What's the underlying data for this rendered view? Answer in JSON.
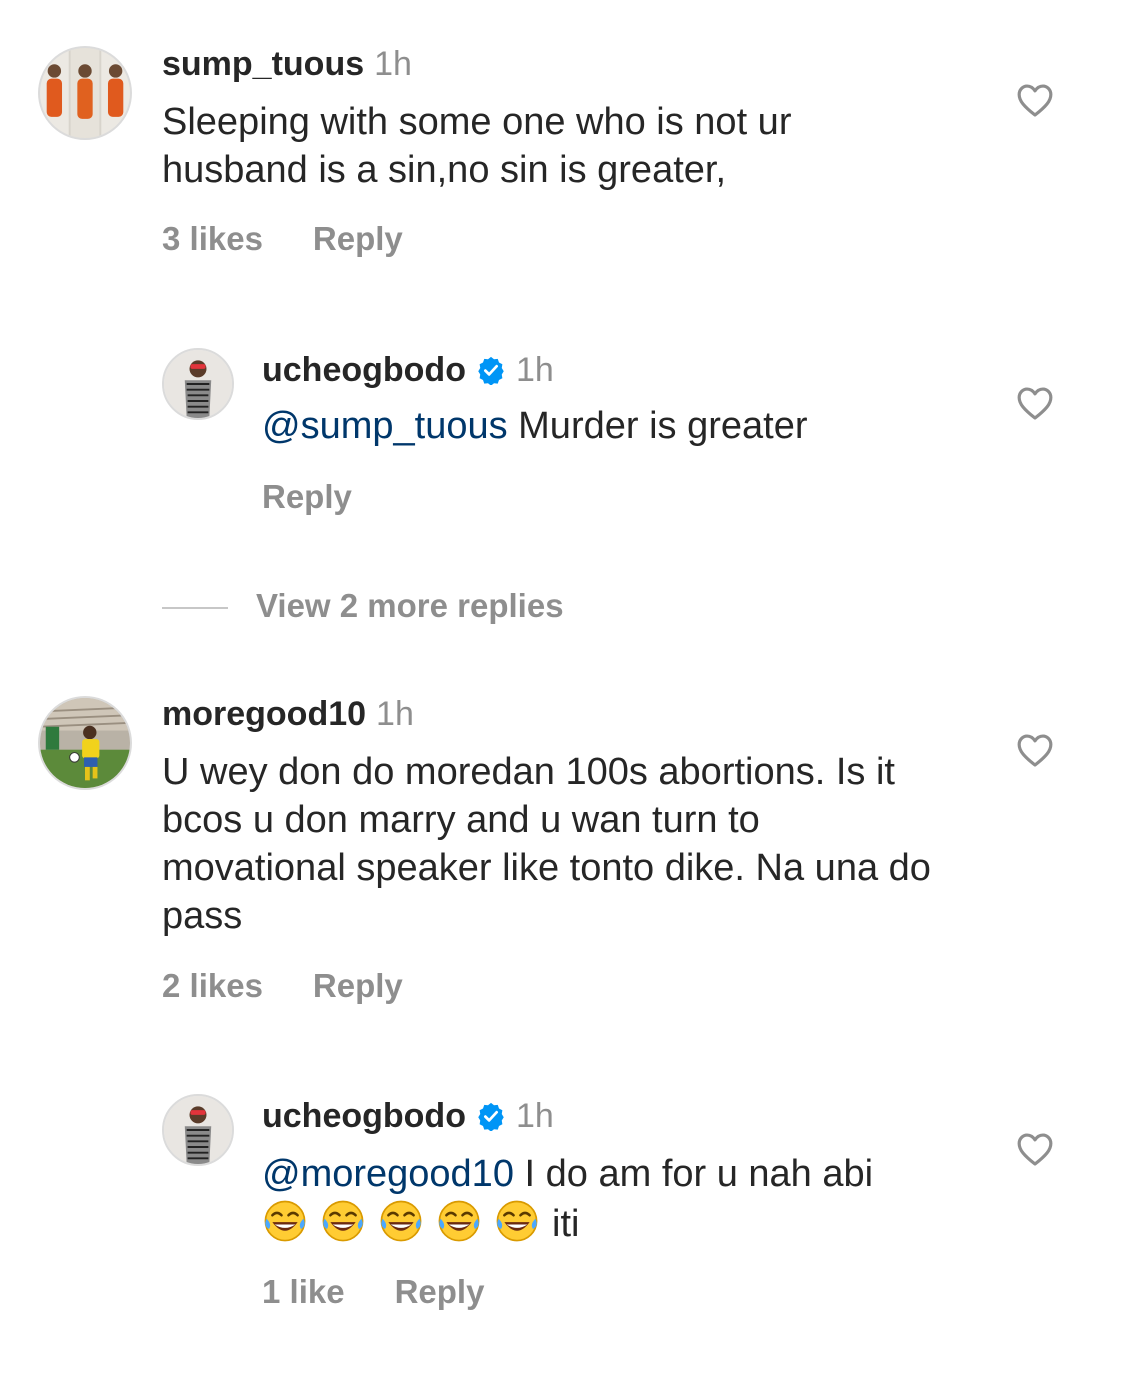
{
  "comments": [
    {
      "username": "sump_tuous",
      "time": "1h",
      "text": "Sleeping with some one who is not ur husband is a sin,no sin is greater,",
      "likes": "3 likes",
      "reply": "Reply"
    },
    {
      "username": "ucheogbodo",
      "verified": true,
      "time": "1h",
      "mention": "@sump_tuous",
      "text": "Murder is greater",
      "reply": "Reply"
    },
    {
      "username": "moregood10",
      "time": "1h",
      "text": "U wey don do moredan 100s abortions. Is it bcos u don marry and u wan turn to movational speaker like tonto dike. Na una do pass",
      "likes": "2 likes",
      "reply": "Reply"
    },
    {
      "username": "ucheogbodo",
      "verified": true,
      "time": "1h",
      "mention": "@moregood10",
      "text": "I do am for u nah abi",
      "emoji": "😂😂😂😂😂",
      "text_after_emoji": "iti",
      "likes": "1 like",
      "reply": "Reply"
    }
  ],
  "view_more_replies": "View 2 more replies",
  "colors": {
    "text": "#262626",
    "secondary": "#8e8e8e",
    "mention": "#00376b",
    "verified": "#0095f6"
  },
  "icons": {
    "like": "heart-outline-icon",
    "verified": "verified-badge-icon",
    "emoji": "face-with-tears-of-joy"
  }
}
